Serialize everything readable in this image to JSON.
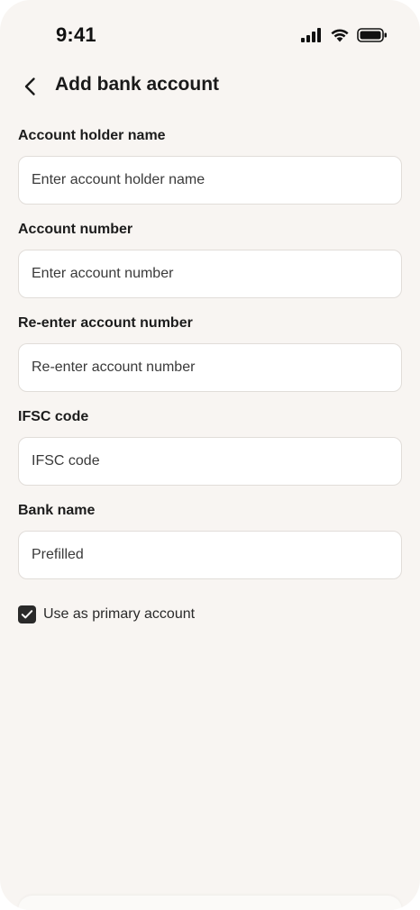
{
  "status_bar": {
    "time": "9:41"
  },
  "header": {
    "title": "Add bank account",
    "back_icon": "chevron-left-icon"
  },
  "form": {
    "fields": [
      {
        "label": "Account holder name",
        "placeholder": "Enter account holder name",
        "value": ""
      },
      {
        "label": "Account number",
        "placeholder": "Enter account number",
        "value": ""
      },
      {
        "label": "Re-enter account number",
        "placeholder": "Re-enter account number",
        "value": ""
      },
      {
        "label": "IFSC code",
        "placeholder": "IFSC code",
        "value": ""
      },
      {
        "label": "Bank name",
        "placeholder": "Prefilled",
        "value": ""
      }
    ],
    "primary_checkbox": {
      "label": "Use as primary account",
      "checked": true
    }
  },
  "colors": {
    "background": "#f8f5f2",
    "input_background": "#ffffff",
    "input_border": "#e1ddd9",
    "checkbox": "#2a2a2a",
    "text": "#1c1c1c"
  }
}
